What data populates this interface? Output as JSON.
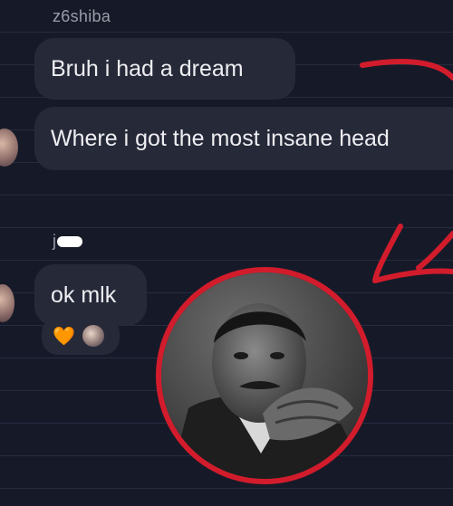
{
  "messages": [
    {
      "sender": "z6shiba",
      "texts": [
        "Bruh i had a dream",
        "Where i got the most insane head"
      ]
    },
    {
      "sender": "j",
      "texts": [
        "ok mlk"
      ]
    }
  ],
  "reactions": {
    "heart_emoji": "🧡"
  },
  "annotations": {
    "accent_color": "#d21c2c"
  },
  "photo": {
    "subject": "Martin Luther King Jr. portrait"
  }
}
